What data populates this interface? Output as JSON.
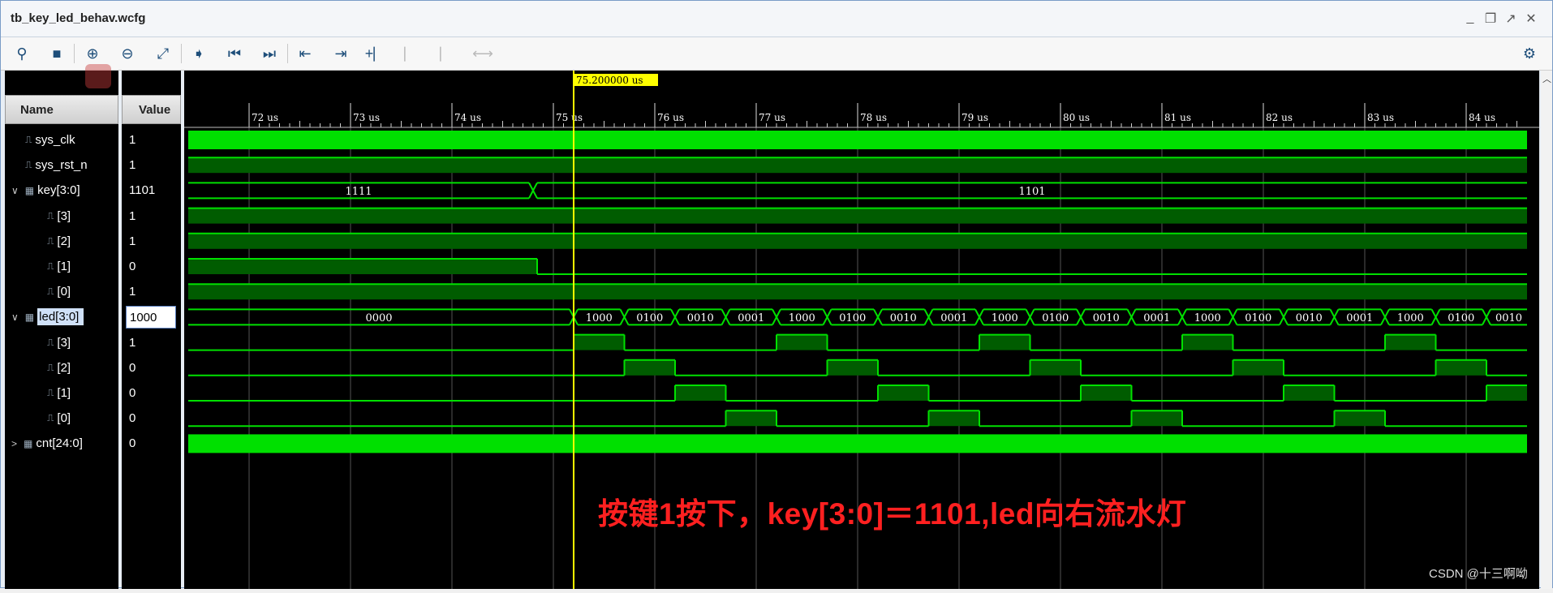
{
  "window": {
    "title": "tb_key_led_behav.wcfg"
  },
  "columns": {
    "name": "Name",
    "value": "Value"
  },
  "cursor": {
    "time_label": "75.200000 us",
    "time_us": 75.2
  },
  "timeline": {
    "ticks": [
      {
        "t": 72,
        "label": "72 us"
      },
      {
        "t": 73,
        "label": "73 us"
      },
      {
        "t": 74,
        "label": "74 us"
      },
      {
        "t": 75,
        "label": "75 us"
      },
      {
        "t": 76,
        "label": "76 us"
      },
      {
        "t": 77,
        "label": "77 us"
      },
      {
        "t": 78,
        "label": "78 us"
      },
      {
        "t": 79,
        "label": "79 us"
      },
      {
        "t": 80,
        "label": "80 us"
      },
      {
        "t": 81,
        "label": "81 us"
      },
      {
        "t": 82,
        "label": "82 us"
      },
      {
        "t": 83,
        "label": "83 us"
      },
      {
        "t": 84,
        "label": "84 us"
      }
    ],
    "start_us": 71.4,
    "end_us": 84.6
  },
  "signals": [
    {
      "name": "sys_clk",
      "value": "1",
      "kind": "bit",
      "expand": ""
    },
    {
      "name": "sys_rst_n",
      "value": "1",
      "kind": "bit",
      "expand": ""
    },
    {
      "name": "key[3:0]",
      "value": "1101",
      "kind": "bus",
      "expand": "∨"
    },
    {
      "name": "[3]",
      "value": "1",
      "kind": "bit",
      "expand": ""
    },
    {
      "name": "[2]",
      "value": "1",
      "kind": "bit",
      "expand": ""
    },
    {
      "name": "[1]",
      "value": "0",
      "kind": "bit",
      "expand": ""
    },
    {
      "name": "[0]",
      "value": "1",
      "kind": "bit",
      "expand": ""
    },
    {
      "name": "led[3:0]",
      "value": "1000",
      "kind": "bus",
      "expand": "∨",
      "selected": true
    },
    {
      "name": "[3]",
      "value": "1",
      "kind": "bit",
      "expand": ""
    },
    {
      "name": "[2]",
      "value": "0",
      "kind": "bit",
      "expand": ""
    },
    {
      "name": "[1]",
      "value": "0",
      "kind": "bit",
      "expand": ""
    },
    {
      "name": "[0]",
      "value": "0",
      "kind": "bit",
      "expand": ""
    },
    {
      "name": "cnt[24:0]",
      "value": "0",
      "kind": "bus",
      "expand": ">"
    }
  ],
  "waves": {
    "sys_clk": "dense",
    "sys_rst_n": [
      [
        71.4,
        84.6,
        1
      ]
    ],
    "key_segments": [
      {
        "from": 71.4,
        "to": 74.8,
        "label": "1111"
      },
      {
        "from": 74.8,
        "to": 84.6,
        "label": "1101"
      }
    ],
    "key3": [
      [
        71.4,
        84.6,
        1
      ]
    ],
    "key2": [
      [
        71.4,
        84.6,
        1
      ]
    ],
    "key1": [
      [
        71.4,
        74.84,
        1
      ],
      [
        74.84,
        84.6,
        0
      ]
    ],
    "key0": [
      [
        71.4,
        84.6,
        1
      ]
    ],
    "led_segments_labels": [
      "0000",
      "1000",
      "0100",
      "0010",
      "0001",
      "1000",
      "0100",
      "0010",
      "0001",
      "1000",
      "0100",
      "0010",
      "0001",
      "1000",
      "0100",
      "0010",
      "0001",
      "1000",
      "0100",
      "0010"
    ],
    "led_start_us": 75.2,
    "led_period_us": 0.5,
    "cnt": "dense"
  },
  "annotation": "按键1按下，key[3:0]＝1101,led向右流水灯",
  "watermark": "CSDN @十三啊呦",
  "colors": {
    "wave": "#00e000",
    "wave_fill": "#005c00",
    "cursor": "#ffff00",
    "grid": "#555555"
  }
}
